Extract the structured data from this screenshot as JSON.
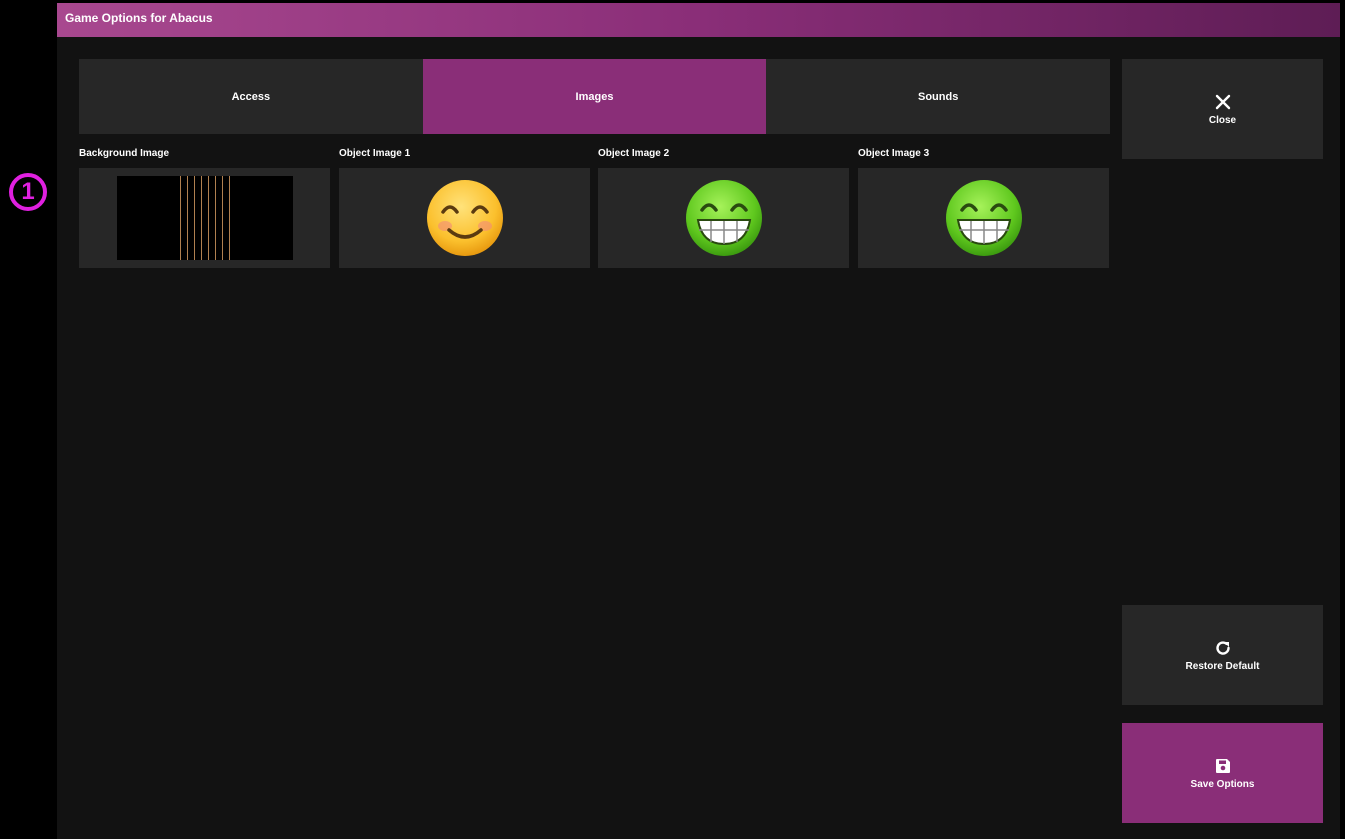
{
  "window": {
    "title": "Game Options for Abacus"
  },
  "tabs": [
    {
      "label": "Access",
      "active": false
    },
    {
      "label": "Images",
      "active": true
    },
    {
      "label": "Sounds",
      "active": false
    }
  ],
  "sidebar": {
    "close_label": "Close",
    "restore_label": "Restore Default",
    "save_label": "Save Options"
  },
  "images": [
    {
      "label": "Background Image",
      "preview": "vertical-lines-background"
    },
    {
      "label": "Object Image 1",
      "preview": "smiling-face-emoji"
    },
    {
      "label": "Object Image 2",
      "preview": "grinning-green-face-emoji"
    },
    {
      "label": "Object Image 3",
      "preview": "grinning-green-face-emoji"
    }
  ],
  "annotation": {
    "marker": "1"
  },
  "colors": {
    "accent": "#8a2e78",
    "panel": "#272727",
    "background": "#121212",
    "marker": "#e020e0"
  },
  "icons": {
    "close": "close-icon",
    "restore": "refresh-icon",
    "save": "save-icon"
  }
}
